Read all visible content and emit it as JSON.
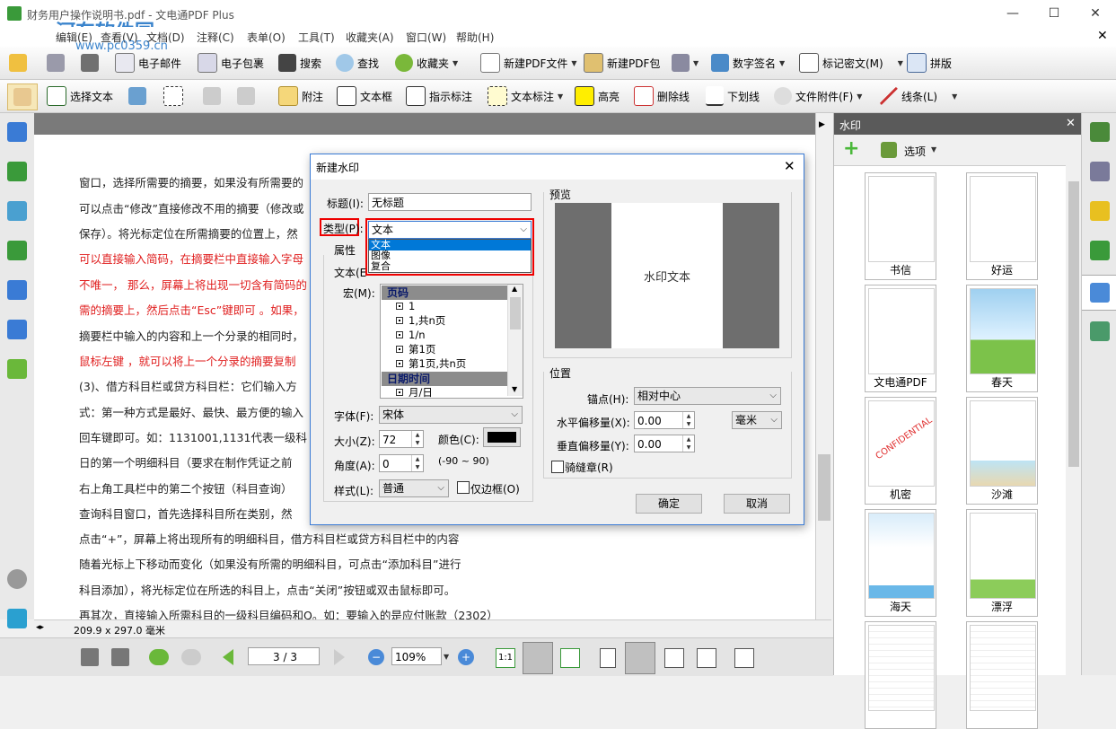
{
  "window": {
    "title": "财务用户操作说明书.pdf - 文电通PDF Plus",
    "watermark_logo": "河东软件园",
    "watermark_url": "www.pc0359.cn",
    "minimize": "—",
    "maximize": "☐",
    "close": "✕",
    "doc_close": "✕"
  },
  "menu": {
    "items": [
      "编辑(E)",
      "查看(V)",
      "文档(D)",
      "注释(C)",
      "表单(O)",
      "工具(T)",
      "收藏夹(A)",
      "窗口(W)",
      "帮助(H)"
    ]
  },
  "toolbar1": {
    "email": "电子邮件",
    "package": "电子包裹",
    "search": "搜索",
    "find": "查找",
    "favorites": "收藏夹",
    "new_pdf": "新建PDF文件",
    "new_pdf_package": "新建PDF包",
    "sign": "数字签名",
    "mark_redact": "标记密文(M)",
    "imposition": "拼版"
  },
  "toolbar2": {
    "select_text": "选择文本",
    "note": "附注",
    "textbox": "文本框",
    "callout": "指示标注",
    "text_markup": "文本标注",
    "highlight": "高亮",
    "strikeout": "删除线",
    "underline": "下划线",
    "file_attach": "文件附件(F)",
    "lines": "线条(L)"
  },
  "document": {
    "lines": [
      {
        "text": "窗口，选择所需要的摘要，如果没有所需要的",
        "red": false
      },
      {
        "text": "可以点击“修改”直接修改不用的摘要（修改或",
        "red": false
      },
      {
        "text": "保存）。将光标定位在所需摘要的位置上，然",
        "red": false
      },
      {
        "text": "可以直接输入简码，在摘要栏中直接输入字母",
        "red": true
      },
      {
        "text": "不唯一， 那么，屏幕上将出现一切含有简码的",
        "red": true
      },
      {
        "text": "需的摘要上，然后点击“Esc”键即可 。如果，",
        "red": true
      },
      {
        "text": "摘要栏中输入的内容和上一个分录的相同时，",
        "red": false
      },
      {
        "text": "鼠标左键 ，就可以将上一个分录的摘要复制",
        "red": true
      },
      {
        "text": "(3)、借方科目栏或贷方科目栏：它们输入方",
        "red": false
      },
      {
        "text": "式：第一种方式是最好、最快、最方便的输入",
        "red": false
      },
      {
        "text": "回车键即可。如：1131001,1131代表一级科",
        "red": false
      },
      {
        "text": "日的第一个明细科目（要求在制作凭证之前",
        "red": false
      },
      {
        "text": "右上角工具栏中的第二个按钮（科目查询）",
        "red": false
      },
      {
        "text": "查询科目窗口，首先选择科目所在类别，然",
        "red": false
      },
      {
        "text": "点击“+”，屏幕上将出现所有的明细科目，借方科目栏或贷方科目栏中的内容",
        "red": false
      },
      {
        "text": "随着光标上下移动而变化（如果没有所需的明细科目，可点击“添加科目”进行",
        "red": false
      },
      {
        "text": "科目添加），将光标定位在所选的科目上，点击“关闭”按钮或双击鼠标即可。",
        "red": false
      },
      {
        "text": "再其次，直接输入所需科目的一级科目编码和Q。如：要输入的是应付账款（2302）",
        "red": false
      }
    ],
    "page_size": "209.9 x 297.0 毫米"
  },
  "navbar": {
    "page_input": "3 / 3",
    "zoom": "109%"
  },
  "watermark_panel": {
    "title": "水印",
    "options": "选项",
    "items": [
      "书信",
      "好运",
      "文电通PDF",
      "春天",
      "机密",
      "沙滩",
      "海天",
      "漂浮",
      "",
      ""
    ],
    "confidential_text": "CONFIDENTIAL"
  },
  "dialog": {
    "title": "新建水印",
    "title_label": "标题(I):",
    "title_value": "无标题",
    "type_label": "类型(P):",
    "type_selected": "文本",
    "type_options": [
      "文本",
      "图像",
      "复合"
    ],
    "attr_tab": "属性",
    "text_label": "文本(E",
    "macro_label": "宏(M):",
    "macro_groups": [
      {
        "header": "页码",
        "items": [
          "1",
          "1,共n页",
          "1/n",
          "第1页",
          "第1页,共n页"
        ]
      },
      {
        "header": "日期时间",
        "items": [
          "月/日"
        ]
      }
    ],
    "font_label": "字体(F):",
    "font_value": "宋体",
    "size_label": "大小(Z):",
    "size_value": "72",
    "color_label": "颜色(C):",
    "angle_label": "角度(A):",
    "angle_value": "0",
    "angle_range": "(-90 ~ 90)",
    "style_label": "样式(L):",
    "style_value": "普通",
    "border_only": "仅边框(O)",
    "preview_label": "预览",
    "preview_text": "水印文本",
    "position_label": "位置",
    "anchor_label": "锚点(H):",
    "anchor_value": "相对中心",
    "h_offset_label": "水平偏移量(X):",
    "h_offset_value": "0.00",
    "unit_value": "毫米",
    "v_offset_label": "垂直偏移量(Y):",
    "v_offset_value": "0.00",
    "seam_stamp": "骑缝章(R)",
    "ok": "确定",
    "cancel": "取消",
    "close": "✕"
  }
}
